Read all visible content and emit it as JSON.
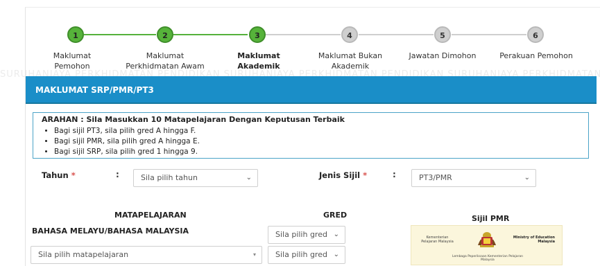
{
  "stepper": {
    "steps": [
      {
        "number": "1",
        "label": "Maklumat Pemohon",
        "status": "done"
      },
      {
        "number": "2",
        "label": "Maklumat Perkhidmatan Awam",
        "status": "done"
      },
      {
        "number": "3",
        "label": "Maklumat Akademik",
        "status": "active"
      },
      {
        "number": "4",
        "label": "Maklumat Bukan Akademik",
        "status": "todo"
      },
      {
        "number": "5",
        "label": "Jawatan Dimohon",
        "status": "todo"
      },
      {
        "number": "6",
        "label": "Perakuan Pemohon",
        "status": "todo"
      }
    ]
  },
  "watermark": "SURUHANJAYA PERKHIDMATAN PENDIDIKAN   SURUHANJAYA PERKHIDMATAN PENDIDIKAN   SURUHANJAYA PERKHIDMATAN PENDIDIKAN",
  "section": {
    "title": "MAKLUMAT SRP/PMR/PT3"
  },
  "instructions": {
    "title": "ARAHAN : Sila Masukkan 10 Matapelajaran Dengan Keputusan Terbaik",
    "items": [
      "Bagi sijil PT3, sila pilih gred A hingga F.",
      "Bagi sijil PMR, sila pilih gred A hingga E.",
      "Bagi sijil SRP, sila pilih gred 1 hingga 9."
    ]
  },
  "form": {
    "tahun": {
      "label": "Tahun",
      "required": "*",
      "colon": ":",
      "value": "Sila pilih tahun"
    },
    "jenis_sijil": {
      "label": "Jenis Sijil",
      "required": "*",
      "colon": ":",
      "value": "PT3/PMR"
    }
  },
  "table": {
    "col_subject": "MATAPELAJARAN",
    "col_grade": "GRED",
    "row1_subject": "BAHASA MELAYU/BAHASA MALAYSIA",
    "row1_grade": "Sila pilih gred",
    "row2_subject": "Sila pilih matapelajaran",
    "row2_grade": "Sila pilih gred"
  },
  "certificate": {
    "title": "Sijil PMR",
    "left_text": "Kementerian Pelajaran Malaysia",
    "right_text": "Ministry of Education Malaysia",
    "bottom_text": "Lembaga Peperiksaan Kementerian Pelajaran Malaysia"
  },
  "icons": {
    "dropdown": "chevron-down-icon"
  }
}
